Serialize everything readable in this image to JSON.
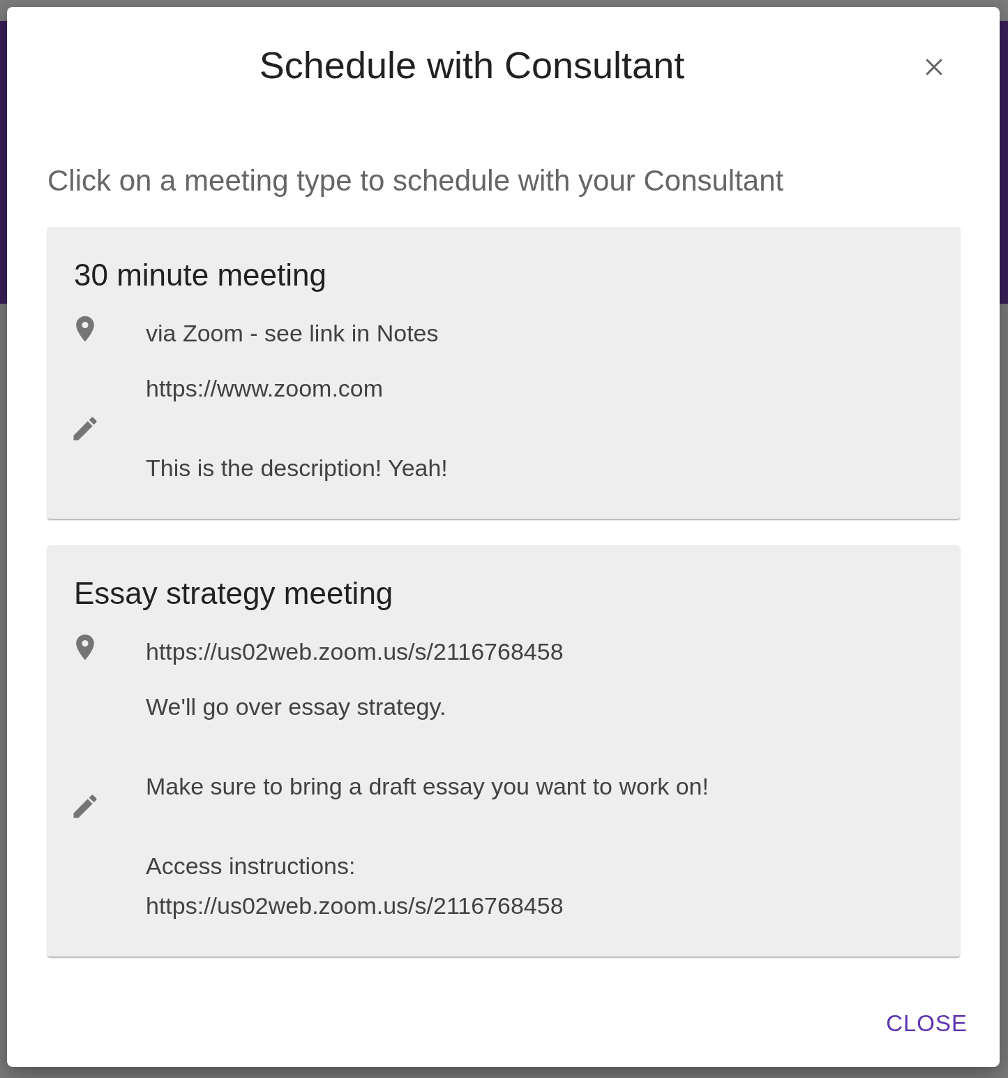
{
  "dialog": {
    "title": "Schedule with Consultant",
    "subtitle": "Click on a meeting type to schedule with your Consultant",
    "meeting_types": [
      {
        "title": "30 minute meeting",
        "location": "via Zoom - see link in Notes",
        "description": "https://www.zoom.com\n\nThis is the description! Yeah!"
      },
      {
        "title": "Essay strategy meeting",
        "location": "https://us02web.zoom.us/s/2116768458",
        "description": "We'll go over essay strategy.\n\nMake sure to bring a draft essay you want to work on!\n\nAccess instructions:\nhttps://us02web.zoom.us/s/2116768458"
      }
    ],
    "buttons": [
      {
        "label": "CLOSE"
      }
    ]
  }
}
